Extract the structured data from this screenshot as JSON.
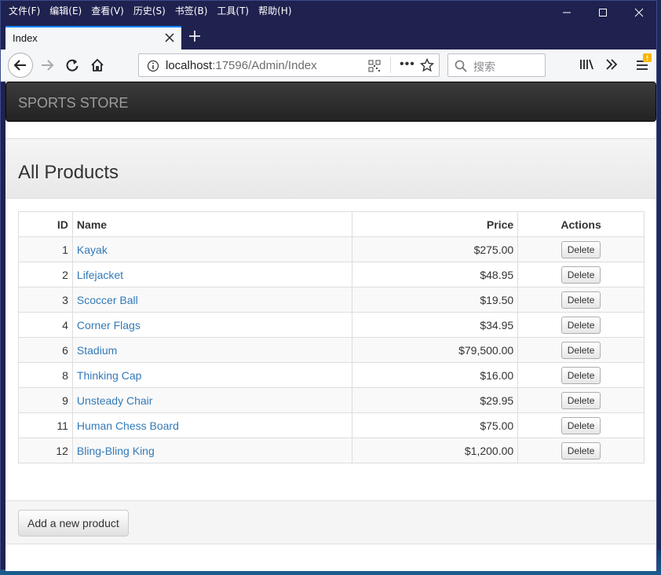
{
  "menu": [
    "文件(F)",
    "编辑(E)",
    "查看(V)",
    "历史(S)",
    "书签(B)",
    "工具(T)",
    "帮助(H)"
  ],
  "tab": {
    "title": "Index"
  },
  "address": {
    "host": "localhost",
    "rest": ":17596/Admin/Index"
  },
  "search": {
    "placeholder": "搜索"
  },
  "brand": "SPORTS STORE",
  "heading": "All Products",
  "table": {
    "headers": {
      "id": "ID",
      "name": "Name",
      "price": "Price",
      "actions": "Actions"
    },
    "rows": [
      {
        "id": "1",
        "name": "Kayak",
        "price": "$275.00"
      },
      {
        "id": "2",
        "name": "Lifejacket",
        "price": "$48.95"
      },
      {
        "id": "3",
        "name": "Scoccer Ball",
        "price": "$19.50"
      },
      {
        "id": "4",
        "name": "Corner Flags",
        "price": "$34.95"
      },
      {
        "id": "6",
        "name": "Stadium",
        "price": "$79,500.00"
      },
      {
        "id": "8",
        "name": "Thinking Cap",
        "price": "$16.00"
      },
      {
        "id": "9",
        "name": "Unsteady Chair",
        "price": "$29.95"
      },
      {
        "id": "11",
        "name": "Human Chess Board",
        "price": "$75.00"
      },
      {
        "id": "12",
        "name": "Bling-Bling King",
        "price": "$1,200.00"
      }
    ],
    "delete_label": "Delete"
  },
  "add_button": "Add a new product",
  "colors": {
    "accent": "#0a84ff",
    "link": "#337ab7",
    "brandbar": "#222222"
  }
}
